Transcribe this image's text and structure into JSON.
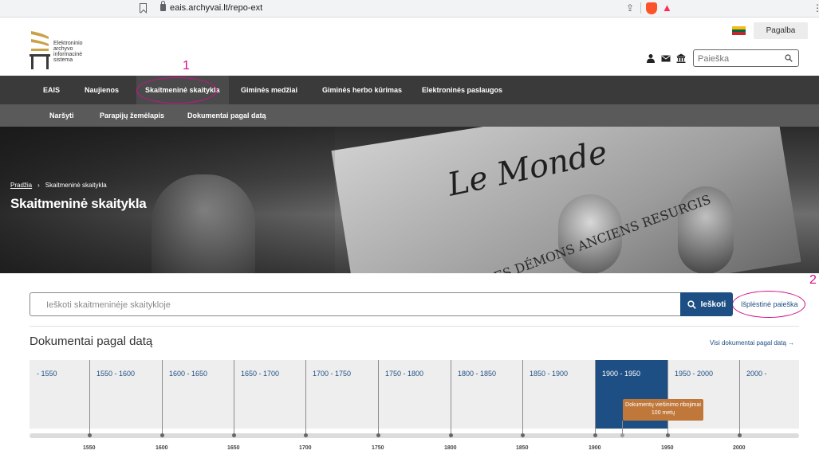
{
  "browser": {
    "url": "eais.archyvai.lt/repo-ext"
  },
  "header": {
    "help_label": "Pagalba",
    "logo_lines": [
      "Elektroninio",
      "archyvo",
      "informacinė",
      "sistema"
    ],
    "search_placeholder": "Paieška",
    "flag_colors": [
      "#fdb913",
      "#006a44",
      "#c1272d"
    ]
  },
  "nav": {
    "main": [
      "EAIS",
      "Naujienos",
      "Skaitmeninė skaitykla",
      "Giminės medžiai",
      "Giminės herbo kūrimas",
      "Elektroninės paslaugos"
    ],
    "active_index": 2,
    "sub": [
      "Naršyti",
      "Parapijų žemėlapis",
      "Dokumentai pagal datą"
    ]
  },
  "hero": {
    "breadcrumb_home": "Pradžia",
    "breadcrumb_sep": "›",
    "breadcrumb_current": "Skaitmeninė skaitykla",
    "title": "Skaitmeninė skaitykla",
    "newspaper_headline": "Le Monde",
    "newspaper_sub": "MACRON: « LES DÉMONS ANCIENS RESURGIS"
  },
  "annotations": {
    "one": "1",
    "two": "2",
    "color": "#d10f8c"
  },
  "search": {
    "placeholder": "Ieškoti skaitmeninėje skaitykloje",
    "button_label": "Ieškoti",
    "advanced_label": "Išplėstinė paieška"
  },
  "timeline": {
    "title": "Dokumentai pagal datą",
    "all_link": "Visi dokumentai pagal datą →",
    "periods": [
      "- 1550",
      "1550 - 1600",
      "1600 - 1650",
      "1650 - 1700",
      "1700 - 1750",
      "1750 - 1800",
      "1800 - 1850",
      "1850 - 1900",
      "1900 - 1950",
      "1950 - 2000",
      "2000 -"
    ],
    "selected_index": 8,
    "axis_years": [
      "1550",
      "1600",
      "1650",
      "1700",
      "1750",
      "1800",
      "1850",
      "1900",
      "1950",
      "2000"
    ],
    "restriction_note": "Dokumentų viešinimo ribojimai 100 metų",
    "accent_color": "#1e4f84",
    "note_color": "#c0783a"
  }
}
